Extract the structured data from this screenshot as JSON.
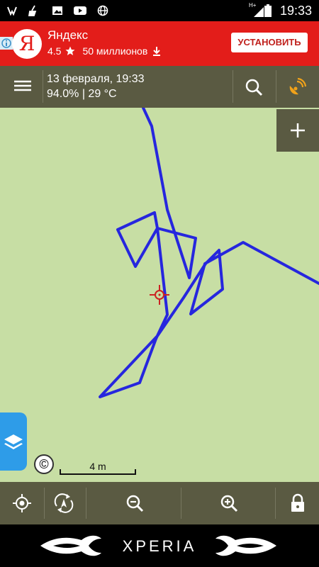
{
  "status_bar": {
    "time": "19:33",
    "network_type": "H+"
  },
  "ad": {
    "app_name": "Яндекс",
    "logo_letter": "Я",
    "rating": "4.5",
    "downloads": "50 миллионов",
    "install_label": "УСТАНОВИТЬ"
  },
  "top_bar": {
    "date_time": "13 февраля, 19:33",
    "battery_temp": "94.0% | 29 °C"
  },
  "map": {
    "scale_label": "4 m",
    "copyright_symbol": "©",
    "background_color": "#c7dea4",
    "track_color": "#2626de",
    "cursor_color": "#cc2222"
  },
  "nav_bar": {
    "brand": "XPERIA"
  }
}
